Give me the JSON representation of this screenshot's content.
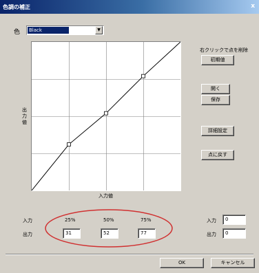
{
  "window": {
    "title": "色調の補正",
    "close_glyph": "x"
  },
  "channel": {
    "label": "色",
    "selected": "Black",
    "arrow_glyph": "▼"
  },
  "right_panel": {
    "hint": "右クリックで点を削除",
    "buttons": {
      "reset": "初期値",
      "open": "開く",
      "save": "保存",
      "detail": "詳細設定",
      "overwrite": "点に戻す"
    }
  },
  "graph": {
    "x_label": "入力値",
    "y_label": "出力値",
    "points": [
      {
        "input": 0,
        "output": 0
      },
      {
        "input": 25,
        "output": 31
      },
      {
        "input": 50,
        "output": 52
      },
      {
        "input": 75,
        "output": 77
      },
      {
        "input": 100,
        "output": 100
      }
    ]
  },
  "table": {
    "input_label": "入力",
    "output_label": "出力",
    "inputs": [
      "25%",
      "50%",
      "75%"
    ],
    "outputs": [
      "31",
      "52",
      "77"
    ]
  },
  "single_point": {
    "input_label": "入力",
    "output_label": "出力",
    "input_value": "0",
    "output_value": "0"
  },
  "footer": {
    "ok": "OK",
    "cancel": "キャンセル"
  },
  "annotation": {
    "ellipse_color": "#d03030"
  },
  "colors": {
    "grid": "#808080",
    "curve": "#000000",
    "face": "#d4d0c8"
  }
}
